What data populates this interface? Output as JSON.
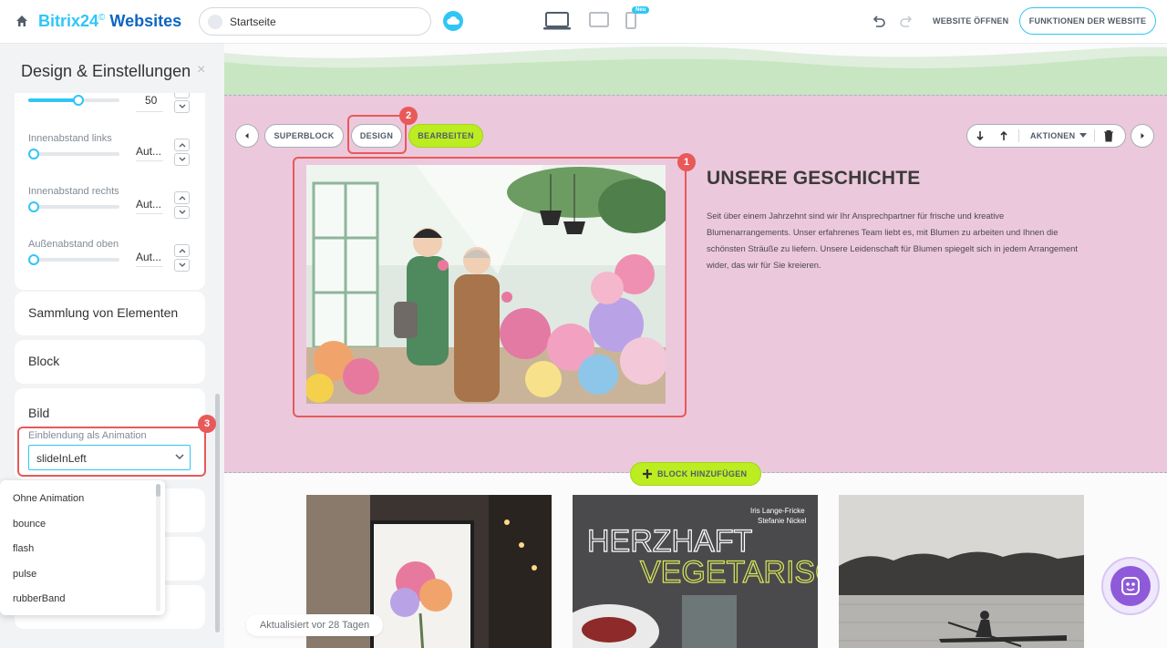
{
  "topbar": {
    "brand_part1": "Bitrix24",
    "brand_symbol": "©",
    "brand_part2": " Websites",
    "page_name": "Startseite",
    "new_badge": "Neu",
    "open_site": "WEBSITE ÖFFNEN",
    "site_features": "FUNKTIONEN DER WEBSITE"
  },
  "panel": {
    "title": "Design & Einstellungen",
    "close": "×",
    "top_slider_value": "50",
    "sliders": [
      {
        "label": "Innenabstand links",
        "value": "Aut..."
      },
      {
        "label": "Innenabstand rechts",
        "value": "Aut..."
      },
      {
        "label": "Außenabstand oben",
        "value": "Aut..."
      }
    ],
    "sections": {
      "collection": "Sammlung von Elementen",
      "block": "Block",
      "image": "Bild"
    },
    "animation_label": "Einblendung als Animation",
    "animation_value": "slideInLeft",
    "animation_options": [
      "Ohne Animation",
      "bounce",
      "flash",
      "pulse",
      "rubberBand"
    ]
  },
  "toolbar": {
    "superblock": "SUPERBLOCK",
    "design": "DESIGN",
    "edit": "BEARBEITEN",
    "actions": "AKTIONEN"
  },
  "callouts": {
    "one": "1",
    "two": "2",
    "three": "3"
  },
  "content": {
    "heading": "UNSERE GESCHICHTE",
    "paragraph": "Seit über einem Jahrzehnt sind wir Ihr Ansprechpartner für frische und kreative Blumenarrangements. Unser erfahrenes Team liebt es, mit Blumen zu arbeiten und Ihnen die schönsten Sträuße zu liefern. Unsere Leidenschaft für Blumen spiegelt sich in jedem Arrangement wider, das wir für Sie kreieren.",
    "add_block": "BLOCK HINZUFÜGEN",
    "updated": "Aktualisiert vor 28 Tagen",
    "book_authors": "Iris Lange-Fricke\nStefanie Nickel",
    "book_title_1": "HERZHAFT",
    "book_title_2": "VEGETARISCH"
  },
  "colors": {
    "accent": "#2fc6f6",
    "green_button": "#bbed21",
    "section_bg": "#ecc8dc",
    "highlight": "#e8595a"
  }
}
